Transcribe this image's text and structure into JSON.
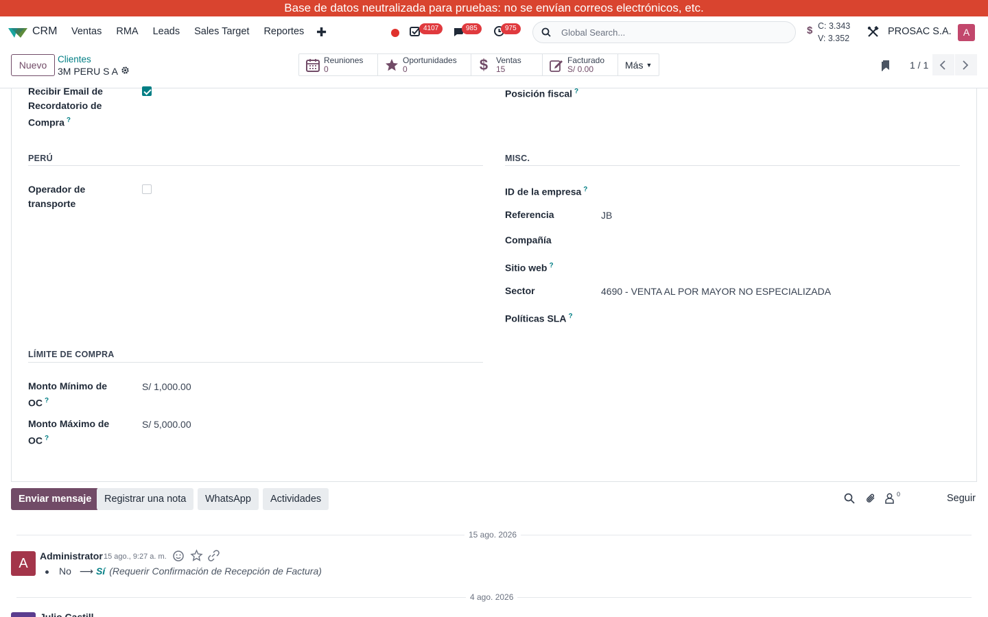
{
  "banner": {
    "text": "Base de datos neutralizada para pruebas: no se envían correos electrónicos, etc."
  },
  "navbar": {
    "app_name": "CRM",
    "menu": [
      "Ventas",
      "RMA",
      "Leads",
      "Sales Target",
      "Reportes"
    ],
    "badges": {
      "activities": "4107",
      "messages": "985",
      "timers": "975"
    },
    "search_placeholder": "Global Search...",
    "currency_symbol": "$",
    "rate_c": "C: 3.343",
    "rate_v": "V: 3.352",
    "company": "PROSAC S.A.",
    "user_initial": "A"
  },
  "control": {
    "new_label": "Nuevo",
    "breadcrumb_parent": "Clientes",
    "breadcrumb_current": "3M PERU S A",
    "stats": [
      {
        "label": "Reuniones",
        "value": "0",
        "icon": "calendar-icon"
      },
      {
        "label": "Oportunidades",
        "value": "0",
        "icon": "star-icon"
      },
      {
        "label": "Ventas",
        "value": "15",
        "icon": "dollar-icon"
      },
      {
        "label": "Facturado",
        "value": "S/ 0.00",
        "icon": "edit-invoice-icon"
      }
    ],
    "more_label": "Más",
    "pager": "1 / 1"
  },
  "form": {
    "email_reminder_label_1": "Recibir Email de",
    "email_reminder_label_2": "Recordatorio de",
    "email_reminder_label_3": "Compra",
    "email_reminder_checked": true,
    "fiscal_position_label": "Posición fiscal",
    "peru_section": "PERÚ",
    "transport_label_1": "Operador de",
    "transport_label_2": "transporte",
    "transport_checked": false,
    "misc_section": "MISC.",
    "company_id_label": "ID de la empresa",
    "reference_label": "Referencia",
    "reference_value": "JB",
    "company_label": "Compañía",
    "website_label": "Sitio web",
    "sector_label": "Sector",
    "sector_value": "4690 - VENTA AL POR MAYOR NO ESPECIALIZADA",
    "sla_label": "Políticas SLA",
    "purchase_limit_section": "LÍMITE DE COMPRA",
    "min_oc_label_1": "Monto Mínimo de",
    "min_oc_label_2": "OC",
    "min_oc_value": "S/ 1,000.00",
    "max_oc_label_1": "Monto Máximo de",
    "max_oc_label_2": "OC",
    "max_oc_value": "S/ 5,000.00",
    "help_mark": "?"
  },
  "chatter": {
    "send_message": "Enviar mensaje",
    "log_note": "Registrar una nota",
    "whatsapp": "WhatsApp",
    "activities": "Actividades",
    "followers_count": "0",
    "follow": "Seguir",
    "date_1": "15 ago. 2026",
    "message": {
      "avatar": "A",
      "author": "Administrator",
      "date": "15 ago., 9:27 a. m.",
      "old_value": "No",
      "new_value": "Sí",
      "field": "(Requerir Confirmación de Recepción de Factura)"
    },
    "date_2": "4 ago. 2026",
    "author_2": "Julio Castill"
  },
  "colors": {
    "brand": "#714b67",
    "accent": "#017e84",
    "banner": "#d9442f",
    "badge": "#e03a3e"
  }
}
